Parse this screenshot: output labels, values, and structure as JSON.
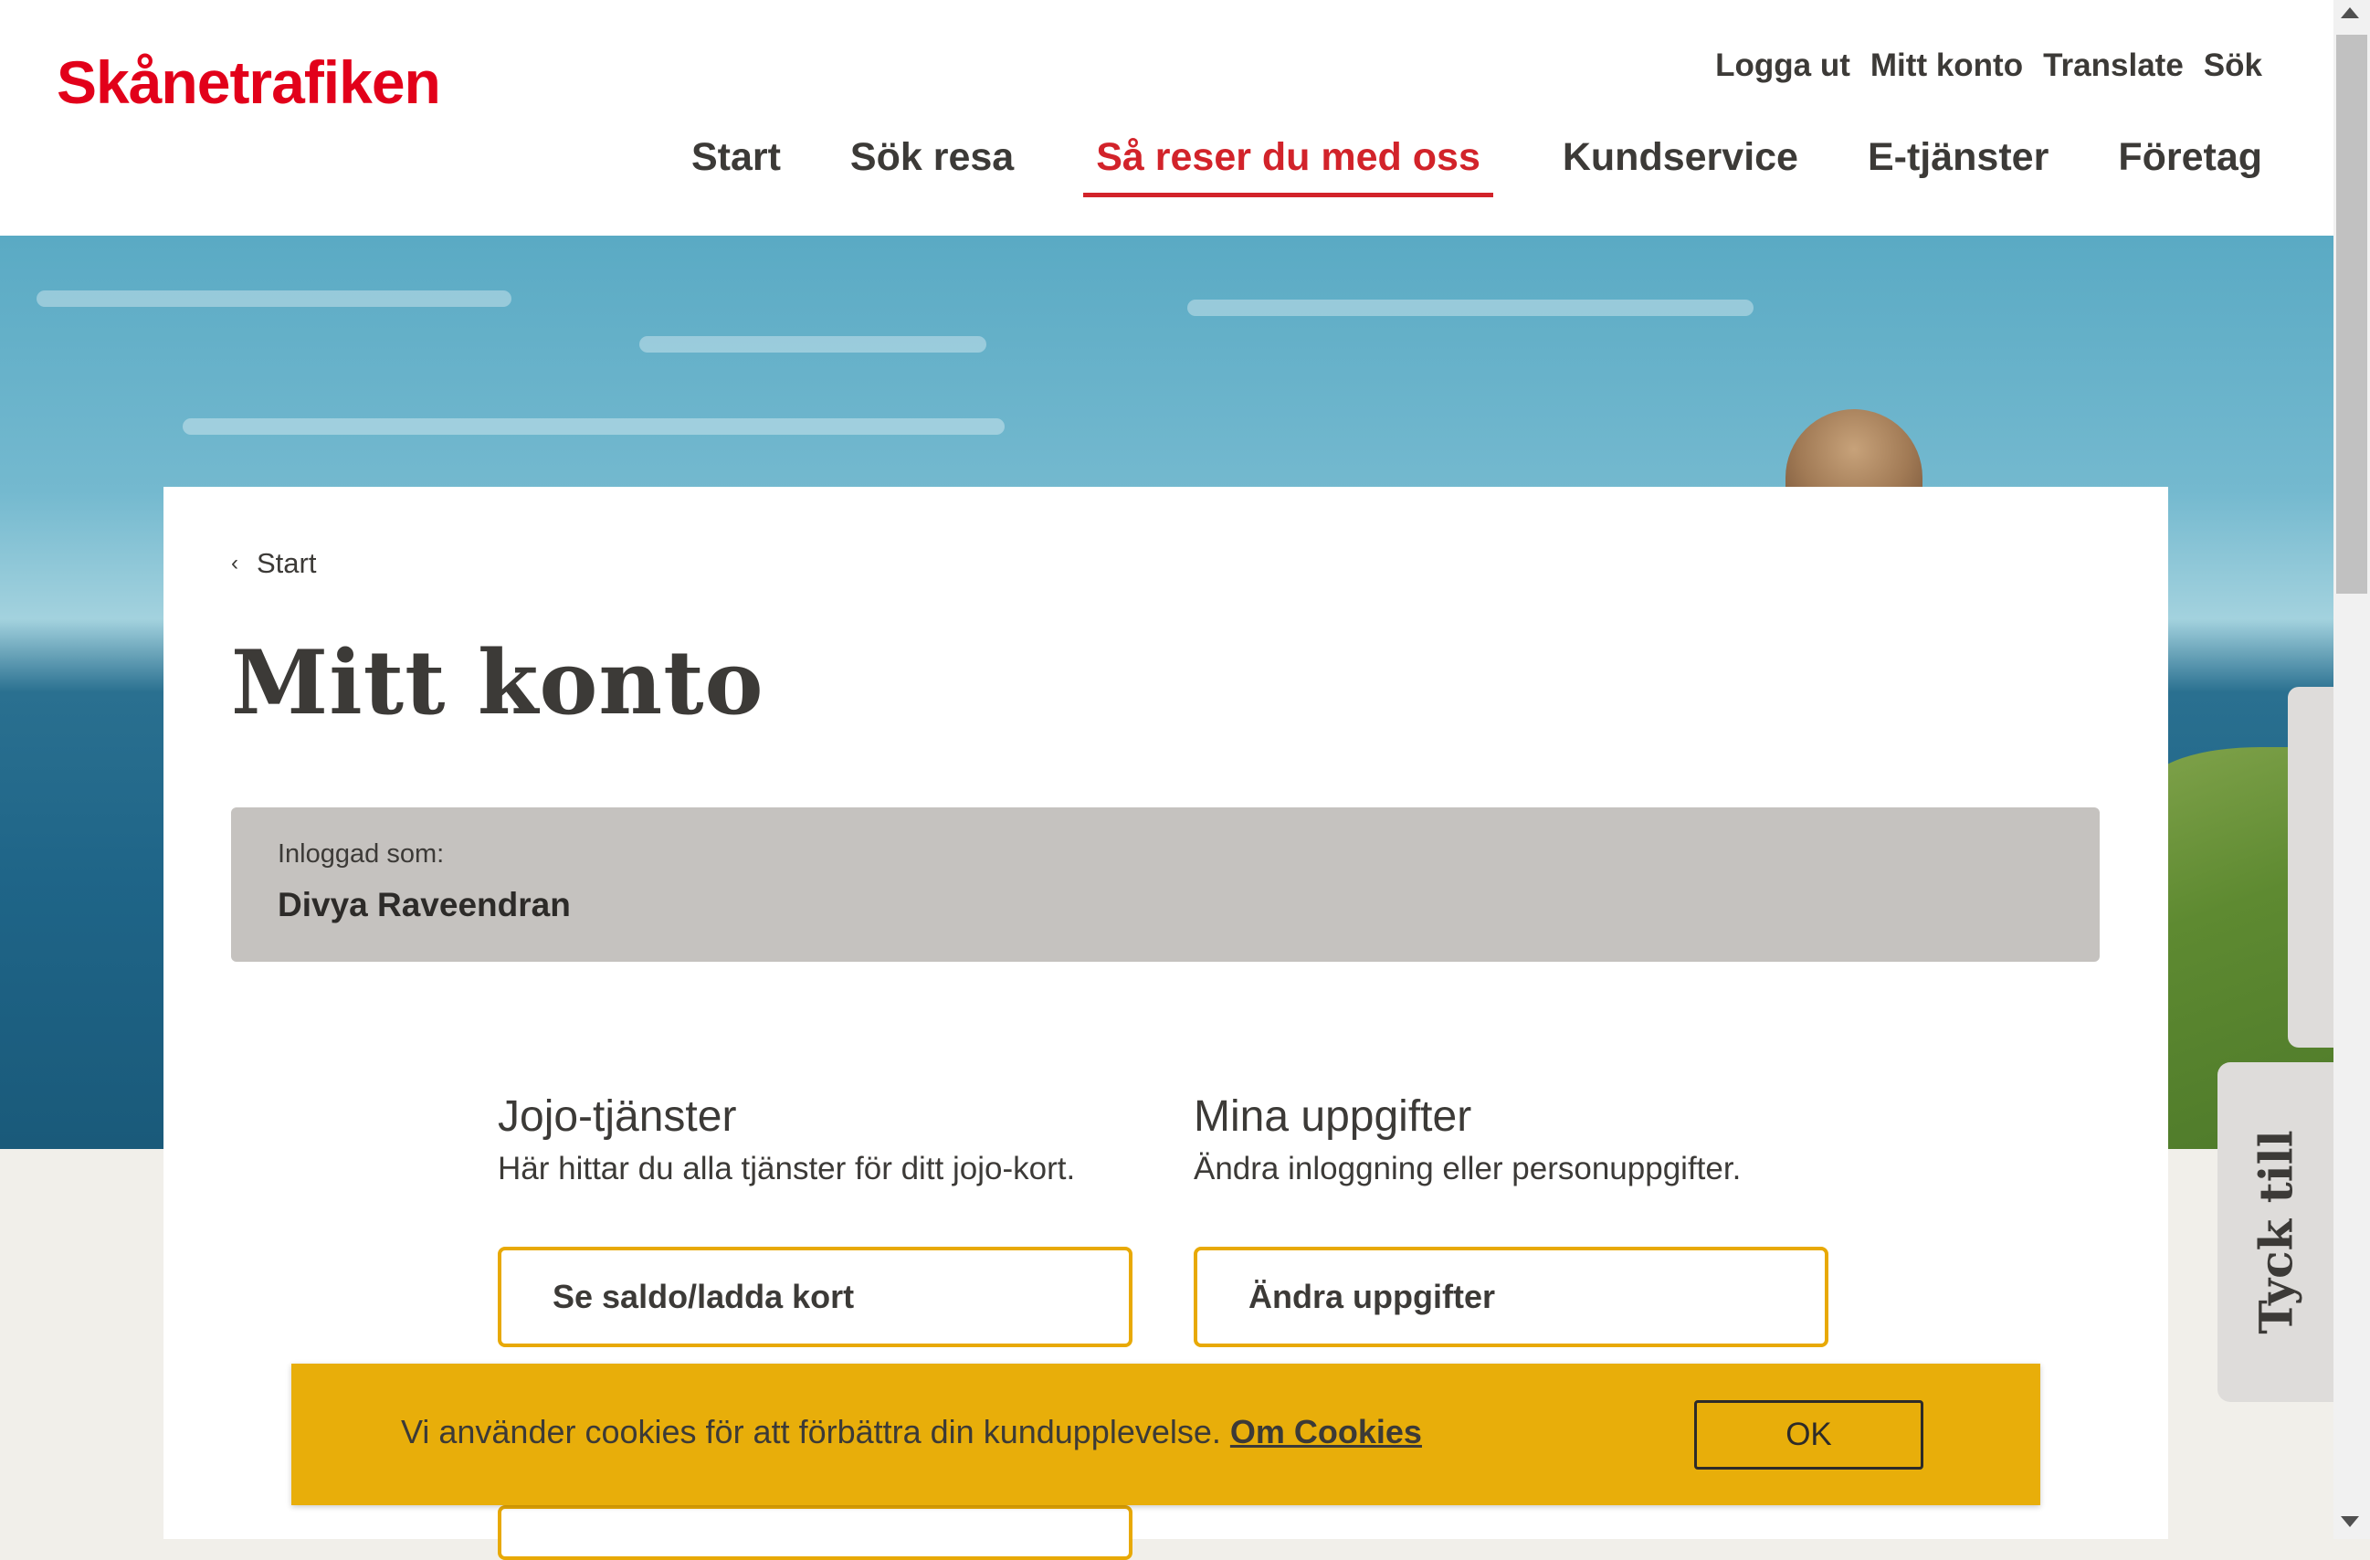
{
  "brand": {
    "logo_text": "Skånetrafiken",
    "primary_color": "#e2001a",
    "accent_color": "#d2232a",
    "yellow": "#e8ae0a"
  },
  "util_nav": [
    "Logga ut",
    "Mitt konto",
    "Translate",
    "Sök"
  ],
  "main_nav": [
    {
      "label": "Start",
      "active": false
    },
    {
      "label": "Sök resa",
      "active": false
    },
    {
      "label": "Så reser du med oss",
      "active": true
    },
    {
      "label": "Kundservice",
      "active": false
    },
    {
      "label": "E-tjänster",
      "active": false
    },
    {
      "label": "Företag",
      "active": false
    }
  ],
  "breadcrumb": {
    "chevron": "‹",
    "label": "Start"
  },
  "page_title": "Mitt konto",
  "user_box": {
    "label": "Inloggad som:",
    "name": "Divya Raveendran"
  },
  "sections": [
    {
      "title": "Jojo-tjänster",
      "description": "Här hittar du alla tjänster för ditt jojo-kort.",
      "button": "Se saldo/ladda kort"
    },
    {
      "title": "Mina uppgifter",
      "description": "Ändra inloggning eller personuppgifter.",
      "button": "Ändra uppgifter"
    }
  ],
  "cookie_banner": {
    "message": "Vi använder cookies för att förbättra din kundupplevelse.",
    "link": "Om Cookies",
    "ok_button": "OK"
  },
  "feedback_tab": "Tyck till"
}
